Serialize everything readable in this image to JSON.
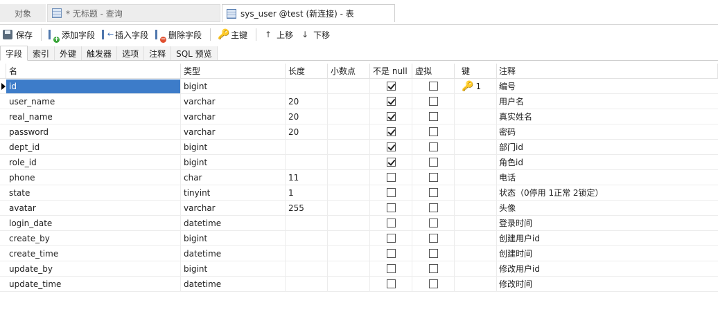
{
  "doc_tabs": {
    "objects": "对象",
    "query": "* 无标题 - 查询",
    "table": "sys_user @test (新连接) - 表"
  },
  "toolbar": {
    "save": "保存",
    "add_field": "添加字段",
    "insert_field": "插入字段",
    "delete_field": "删除字段",
    "primary_key": "主键",
    "move_up": "上移",
    "move_down": "下移"
  },
  "subtabs": [
    "字段",
    "索引",
    "外键",
    "触发器",
    "选项",
    "注释",
    "SQL 预览"
  ],
  "columns": {
    "name": "名",
    "type": "类型",
    "length": "长度",
    "decimals": "小数点",
    "not_null": "不是 null",
    "virtual": "虚拟",
    "key": "键",
    "comment": "注释"
  },
  "rows": [
    {
      "name": "id",
      "type": "bigint",
      "length": "",
      "decimals": "",
      "not_null": true,
      "virtual": false,
      "key": "1",
      "comment": "编号"
    },
    {
      "name": "user_name",
      "type": "varchar",
      "length": "20",
      "decimals": "",
      "not_null": true,
      "virtual": false,
      "key": "",
      "comment": "用户名"
    },
    {
      "name": "real_name",
      "type": "varchar",
      "length": "20",
      "decimals": "",
      "not_null": true,
      "virtual": false,
      "key": "",
      "comment": "真实姓名"
    },
    {
      "name": "password",
      "type": "varchar",
      "length": "20",
      "decimals": "",
      "not_null": true,
      "virtual": false,
      "key": "",
      "comment": "密码"
    },
    {
      "name": "dept_id",
      "type": "bigint",
      "length": "",
      "decimals": "",
      "not_null": true,
      "virtual": false,
      "key": "",
      "comment": "部门id"
    },
    {
      "name": "role_id",
      "type": "bigint",
      "length": "",
      "decimals": "",
      "not_null": true,
      "virtual": false,
      "key": "",
      "comment": "角色id"
    },
    {
      "name": "phone",
      "type": "char",
      "length": "11",
      "decimals": "",
      "not_null": false,
      "virtual": false,
      "key": "",
      "comment": "电话"
    },
    {
      "name": "state",
      "type": "tinyint",
      "length": "1",
      "decimals": "",
      "not_null": false,
      "virtual": false,
      "key": "",
      "comment": "状态（0停用 1正常 2锁定）"
    },
    {
      "name": "avatar",
      "type": "varchar",
      "length": "255",
      "decimals": "",
      "not_null": false,
      "virtual": false,
      "key": "",
      "comment": "头像"
    },
    {
      "name": "login_date",
      "type": "datetime",
      "length": "",
      "decimals": "",
      "not_null": false,
      "virtual": false,
      "key": "",
      "comment": "登录时间"
    },
    {
      "name": "create_by",
      "type": "bigint",
      "length": "",
      "decimals": "",
      "not_null": false,
      "virtual": false,
      "key": "",
      "comment": "创建用户id"
    },
    {
      "name": "create_time",
      "type": "datetime",
      "length": "",
      "decimals": "",
      "not_null": false,
      "virtual": false,
      "key": "",
      "comment": "创建时间"
    },
    {
      "name": "update_by",
      "type": "bigint",
      "length": "",
      "decimals": "",
      "not_null": false,
      "virtual": false,
      "key": "",
      "comment": "修改用户id"
    },
    {
      "name": "update_time",
      "type": "datetime",
      "length": "",
      "decimals": "",
      "not_null": false,
      "virtual": false,
      "key": "",
      "comment": "修改时间"
    }
  ],
  "selected_row": 0,
  "colors": {
    "selection": "#3d7cc9",
    "key_icon": "#d19a00"
  }
}
